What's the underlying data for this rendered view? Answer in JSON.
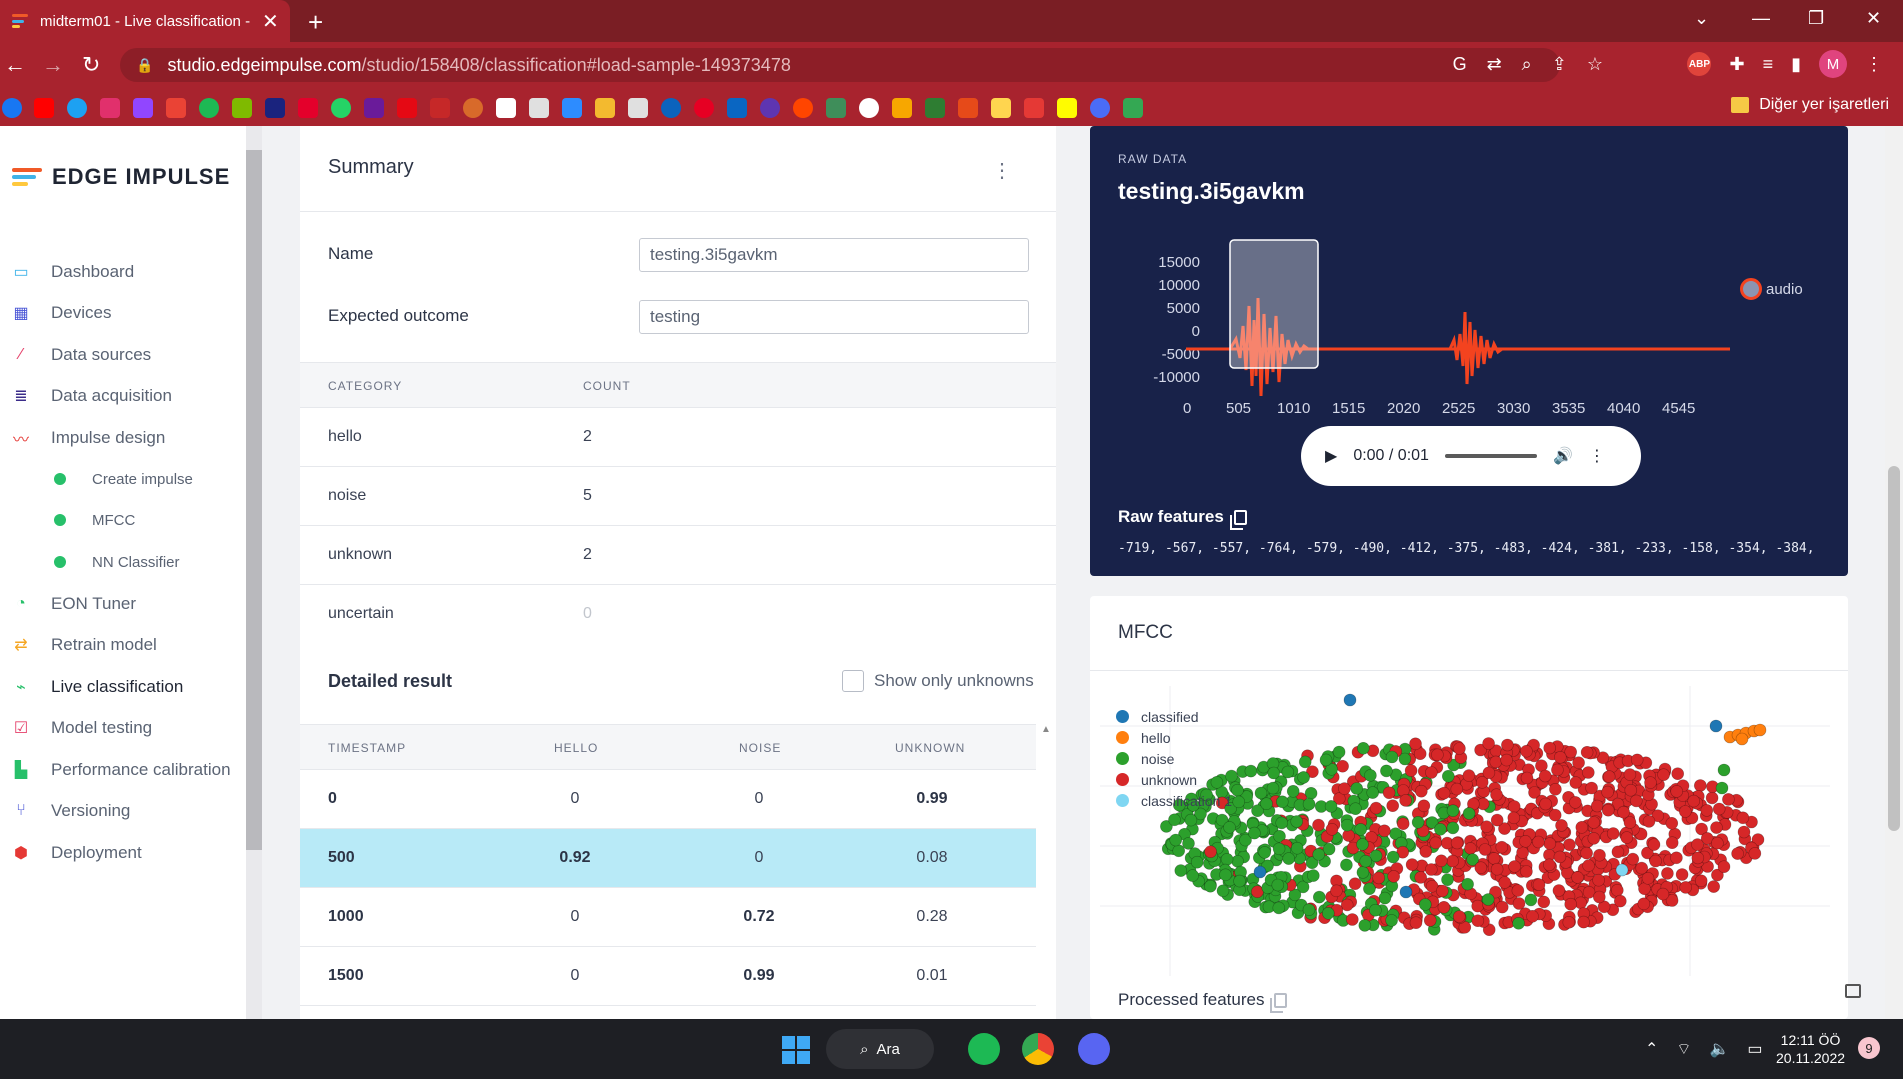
{
  "browser": {
    "tab_title": "midterm01 - Live classification - Edge Impulse",
    "url_host": "studio.edgeimpulse.com",
    "url_path": "/studio/158408/classification#load-sample-149373478",
    "bookmarks_folder": "Diğer yer işaretleri",
    "profile_initial": "M",
    "abp_label": "ABP"
  },
  "sidebar": {
    "brand": "EDGE IMPULSE",
    "items": [
      {
        "label": "Dashboard",
        "icon": "monitor-icon"
      },
      {
        "label": "Devices",
        "icon": "chip-icon"
      },
      {
        "label": "Data sources",
        "icon": "wand-icon"
      },
      {
        "label": "Data acquisition",
        "icon": "database-icon"
      },
      {
        "label": "Impulse design",
        "icon": "pulse-icon"
      },
      {
        "label": "Create impulse",
        "icon": "dot-icon"
      },
      {
        "label": "MFCC",
        "icon": "dot-icon"
      },
      {
        "label": "NN Classifier",
        "icon": "dot-icon"
      },
      {
        "label": "EON Tuner",
        "icon": "gauge-icon"
      },
      {
        "label": "Retrain model",
        "icon": "shuffle-icon"
      },
      {
        "label": "Live classification",
        "icon": "broadcast-icon"
      },
      {
        "label": "Model testing",
        "icon": "clipboard-check-icon"
      },
      {
        "label": "Performance calibration",
        "icon": "bar-chart-icon"
      },
      {
        "label": "Versioning",
        "icon": "branch-icon"
      },
      {
        "label": "Deployment",
        "icon": "box-icon"
      }
    ]
  },
  "summary": {
    "title": "Summary",
    "name_label": "Name",
    "name_value": "testing.3i5gavkm",
    "expected_label": "Expected outcome",
    "expected_value": "testing",
    "col_category": "CATEGORY",
    "col_count": "COUNT",
    "rows": [
      {
        "category": "hello",
        "count": "2"
      },
      {
        "category": "noise",
        "count": "5"
      },
      {
        "category": "unknown",
        "count": "2"
      },
      {
        "category": "uncertain",
        "count": "0"
      }
    ]
  },
  "detailed": {
    "title": "Detailed result",
    "checkbox_label": "Show only unknowns",
    "headers": [
      "TIMESTAMP",
      "HELLO",
      "NOISE",
      "UNKNOWN"
    ],
    "rows": [
      {
        "timestamp": "0",
        "hello": "0",
        "noise": "0",
        "unknown": "0.99"
      },
      {
        "timestamp": "500",
        "hello": "0.92",
        "noise": "0",
        "unknown": "0.08"
      },
      {
        "timestamp": "1000",
        "hello": "0",
        "noise": "0.72",
        "unknown": "0.28"
      },
      {
        "timestamp": "1500",
        "hello": "0",
        "noise": "0.99",
        "unknown": "0.01"
      }
    ]
  },
  "raw": {
    "small_label": "RAW DATA",
    "title": "testing.3i5gavkm",
    "y_ticks": [
      "15000",
      "10000",
      "5000",
      "0",
      "-5000",
      "-10000"
    ],
    "x_ticks": [
      "0",
      "505",
      "1010",
      "1515",
      "2020",
      "2525",
      "3030",
      "3535",
      "4040",
      "4545"
    ],
    "legend": "audio",
    "player_time": "0:00 / 0:01",
    "features_title": "Raw features",
    "features_values": "-719, -567, -557, -764, -579, -490, -412, -375, -483, -424, -381, -233, -158, -354, -384, -43…"
  },
  "mfcc": {
    "title": "MFCC",
    "legend": [
      {
        "label": "classified",
        "color": "#1f77b4"
      },
      {
        "label": "hello",
        "color": "#ff7f0e"
      },
      {
        "label": "noise",
        "color": "#2ca02c"
      },
      {
        "label": "unknown",
        "color": "#d62728"
      },
      {
        "label": "classification 1",
        "color": "#7fd6f2"
      }
    ],
    "processed_title": "Processed features"
  },
  "taskbar": {
    "search_label": "Ara",
    "time": "12:11 ÖÖ",
    "date": "20.11.2022",
    "badge": "9"
  }
}
